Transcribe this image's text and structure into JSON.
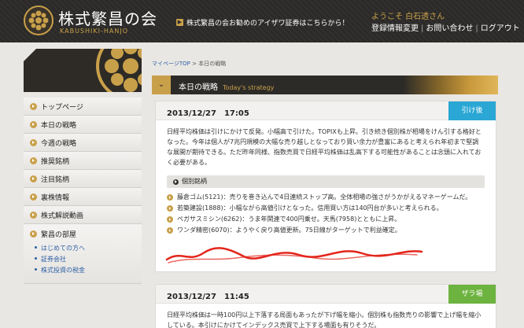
{
  "header": {
    "logo_title": "株式繁昌の会",
    "logo_sub": "KABUSHIKI-HANJO",
    "promo": "株式繁昌の会お勧めのアイザワ証券はこちらから！",
    "welcome": "ようこそ 白石透さん",
    "links": [
      "登録情報変更",
      "お問い合わせ",
      "ログアウト"
    ],
    "link_separator": "|"
  },
  "sidebar": {
    "items": [
      {
        "label": "トップページ"
      },
      {
        "label": "本日の戦略"
      },
      {
        "label": "今週の戦略"
      },
      {
        "label": "推奨銘柄"
      },
      {
        "label": "注目銘柄"
      },
      {
        "label": "裏株情報"
      },
      {
        "label": "株式解説動画"
      }
    ],
    "club": {
      "label": "繁昌の部屋",
      "links": [
        "はじめての方へ",
        "証券会社",
        "株式投資の税金"
      ]
    }
  },
  "breadcrumb": {
    "home": "マイページTOP",
    "separator": ">",
    "current": "本日の戦略"
  },
  "page_title": {
    "ja": "本日の戦略",
    "en": "Today's strategy"
  },
  "posts": [
    {
      "date": "2013/12/27　17:05",
      "badge": "引け後",
      "badge_color": "#2aa7d4",
      "body": "日経平均株価は引けにかけて反発。小幅高で引けた。TOPIXも上昇。引き続き個別株が相場をけん引する格好となった。今年は個人が7兆円規模の大幅な売り越しとなっており買い余力が豊富にあると考えられ年初まで堅調な展開が期待できる。ただ昨年同様、指数売買で日経平均株価は乱高下する可能性があることは念頭に入れておく必要がある。",
      "stocks_title": "個別銘柄",
      "stocks": [
        "藤倉ゴム(5121)：売りを巻き込んで4日連続ストップ高。全体相場の強さがうかがえるマネーゲームだ。",
        "若築建設(1888)：小幅ながら高値引けとなった。信用買い方は140円台が多いと考えられる。",
        "ペガサスミシン(6262)：うま年関連で400円乗せ。天馬(7958)とともに上昇。",
        "ワンダ精密(6070)：ようやく戻り高値更新。75日線がターゲットで利益確定。"
      ]
    },
    {
      "date": "2013/12/27　11:45",
      "badge": "ザラ場",
      "badge_color": "#6db33f",
      "body": "日経平均株価は一時100円以上下落する局面もあったが下げ幅を縮小。個別株も指数売りの影響で上げ幅を縮小している。本引けにかけてインデックス売買で上下する場面も有りそうだ。"
    }
  ]
}
